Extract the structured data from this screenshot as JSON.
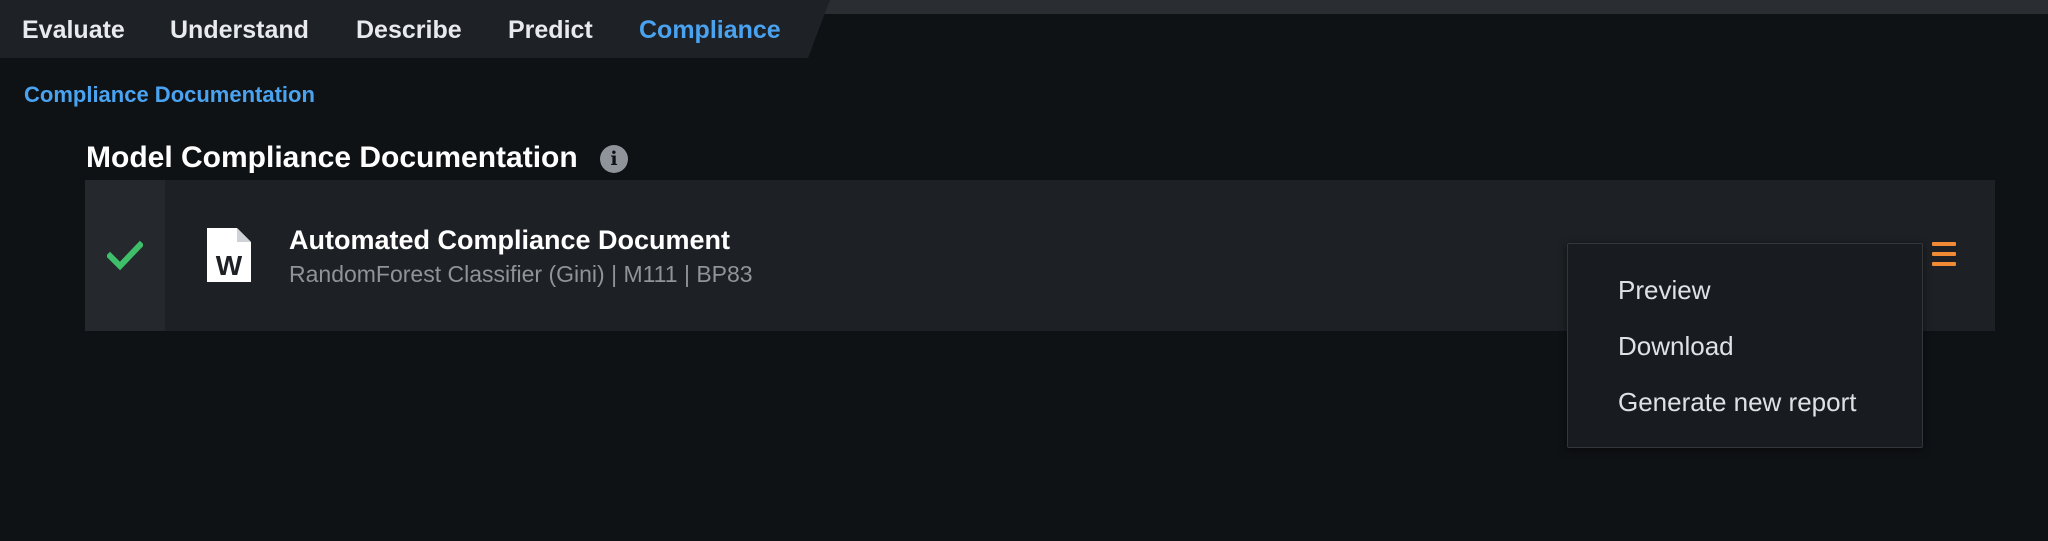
{
  "tabs": [
    {
      "label": "Evaluate",
      "active": false
    },
    {
      "label": "Understand",
      "active": false
    },
    {
      "label": "Describe",
      "active": false
    },
    {
      "label": "Predict",
      "active": false
    },
    {
      "label": "Compliance",
      "active": true
    }
  ],
  "subnav": {
    "label": "Compliance Documentation"
  },
  "section": {
    "title": "Model Compliance Documentation",
    "info_icon": "info-icon"
  },
  "document": {
    "status_icon": "check-icon",
    "file_icon": "word-document-icon",
    "title": "Automated Compliance Document",
    "subtitle": "RandomForest Classifier (Gini) | M111 | BP83",
    "menu_icon": "hamburger-menu-icon"
  },
  "menu": {
    "items": [
      "Preview",
      "Download",
      "Generate new report"
    ]
  },
  "colors": {
    "background": "#0f1215",
    "accent": "#4aa3f0",
    "success": "#3fbf6a",
    "menu_icon": "#f08a34"
  }
}
